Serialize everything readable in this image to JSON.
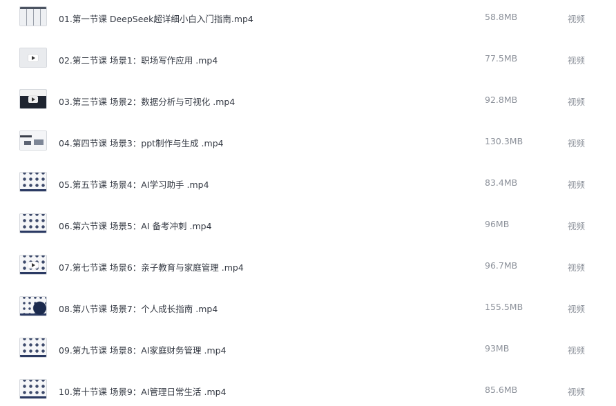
{
  "files": [
    {
      "name": "01.第一节课 DeepSeek超详细小白入门指南.mp4",
      "size": "58.8MB",
      "type": "视频",
      "thumbnail": "table-icon"
    },
    {
      "name": "02.第二节课 场景1：职场写作应用 .mp4",
      "size": "77.5MB",
      "type": "视频",
      "thumbnail": "slide-play-icon"
    },
    {
      "name": "03.第三节课 场景2：数据分析与可视化 .mp4",
      "size": "92.8MB",
      "type": "视频",
      "thumbnail": "dark-slide-play-icon"
    },
    {
      "name": "04.第四节课 场景3：ppt制作与生成 .mp4",
      "size": "130.3MB",
      "type": "视频",
      "thumbnail": "ppt-slide-icon"
    },
    {
      "name": "05.第五节课 场景4：AI学习助手 .mp4",
      "size": "83.4MB",
      "type": "视频",
      "thumbnail": "icon-grid-icon"
    },
    {
      "name": "06.第六节课 场景5：AI 备考冲刺 .mp4",
      "size": "96MB",
      "type": "视频",
      "thumbnail": "icon-grid-icon"
    },
    {
      "name": "07.第七节课 场景6：亲子教育与家庭管理 .mp4",
      "size": "96.7MB",
      "type": "视频",
      "thumbnail": "icon-grid-play-icon"
    },
    {
      "name": "08.第八节课 场景7：个人成长指南 .mp4",
      "size": "155.5MB",
      "type": "视频",
      "thumbnail": "dark-circle-icon"
    },
    {
      "name": "09.第九节课 场景8：AI家庭财务管理 .mp4",
      "size": "93MB",
      "type": "视频",
      "thumbnail": "icon-grid-icon"
    },
    {
      "name": "10.第十节课 场景9：AI管理日常生活 .mp4",
      "size": "85.6MB",
      "type": "视频",
      "thumbnail": "icon-grid-icon"
    }
  ]
}
